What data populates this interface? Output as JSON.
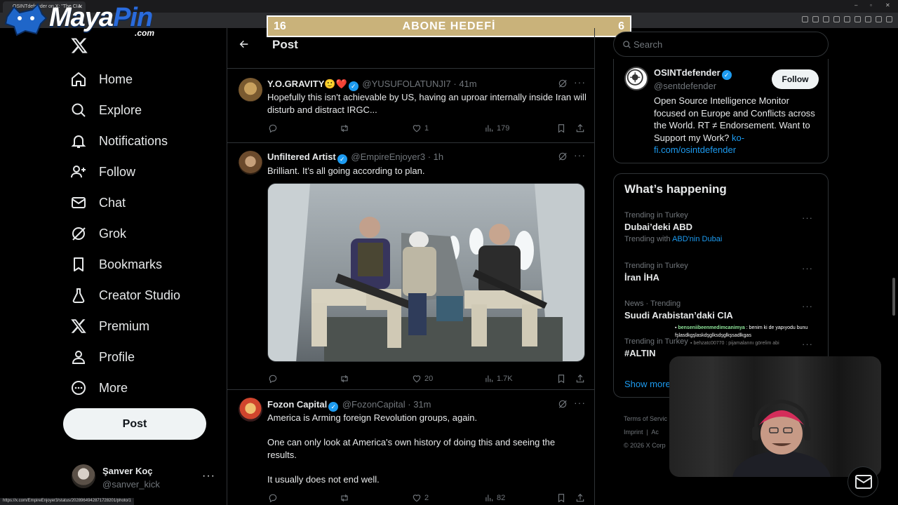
{
  "browser": {
    "tab_title": "OSINTdefender on X: \"The CIA",
    "status_url": "https://x.com/EmpireEnjoyer3/status/2028964942871728201/photo/1"
  },
  "overlay": {
    "logo": {
      "maya": "Maya",
      "pin": "Pin",
      "com": ".com"
    },
    "goal": {
      "left": "16",
      "label": "ABONE HEDEFİ",
      "right": "6"
    }
  },
  "nav": {
    "items": [
      {
        "label": "Home",
        "icon": "home-icon"
      },
      {
        "label": "Explore",
        "icon": "search-icon"
      },
      {
        "label": "Notifications",
        "icon": "bell-icon"
      },
      {
        "label": "Follow",
        "icon": "add-user-icon"
      },
      {
        "label": "Chat",
        "icon": "mail-icon"
      },
      {
        "label": "Grok",
        "icon": "grok-icon"
      },
      {
        "label": "Bookmarks",
        "icon": "bookmark-icon"
      },
      {
        "label": "Creator Studio",
        "icon": "flask-icon"
      },
      {
        "label": "Premium",
        "icon": "x-icon"
      },
      {
        "label": "Profile",
        "icon": "person-icon"
      },
      {
        "label": "More",
        "icon": "more-circle-icon"
      }
    ],
    "post_label": "Post",
    "account": {
      "name": "Şanver Koç",
      "handle": "@sanver_kick",
      "more": "···"
    }
  },
  "main": {
    "title": "Post",
    "tweets": [
      {
        "name": "Y.O.GRAVITY",
        "emoji": "🙂❤️",
        "handle": "@YUSUFOLATUNJI7",
        "time": "· 41m",
        "body": [
          "Hopefully this isn't achievable by US, having an uproar internally inside Iran will disturb and distract IRGC..."
        ],
        "likes": "1",
        "views": "179"
      },
      {
        "name": "Unfiltered Artist",
        "handle": "@EmpireEnjoyer3",
        "time": "· 1h",
        "body": [
          "Brilliant. It’s all going according to plan."
        ],
        "likes": "20",
        "views": "1.7K"
      },
      {
        "name": "Fozon Capital",
        "handle": "@FozonCapital",
        "time": "· 31m",
        "body": [
          "America is Arming foreign Revolution groups, again.",
          "One can only look at America's own history of doing this and seeing the results.",
          "It usually does not end well."
        ],
        "likes": "2",
        "views": "82"
      }
    ]
  },
  "sidebar": {
    "search_placeholder": "Search",
    "profile": {
      "name": "OSINTdefender",
      "handle": "@sentdefender",
      "follow_label": "Follow",
      "bio": "Open Source Intelligence Monitor focused on Europe and Conflicts across the World. RT ≠ Endorsement. Want to Support my Work? ",
      "link": "ko-fi.com/osintdefender"
    },
    "happening_title": "What’s happening",
    "trends": [
      {
        "context": "Trending in Turkey",
        "name": "Dubai’deki ABD",
        "with_label": "Trending with",
        "with_link": "ABD'nin Dubai"
      },
      {
        "context": "Trending in Turkey",
        "name": "İran İHA"
      },
      {
        "context": "News · Trending",
        "name": "Suudi Arabistan’daki CIA"
      },
      {
        "context": "Trending in Turkey",
        "name": "#ALTIN"
      }
    ],
    "show_more": "Show more",
    "footer": {
      "line1": "Terms of Servic",
      "imprint": "Imprint",
      "sep": "|",
      "acc": "Ac",
      "copy": "© 2026 X Corp"
    }
  },
  "stream_chat": [
    {
      "user": "benseniibeenmedimcanimya",
      "text": " : benim ki de yapıyodu bunu fşlasdkgşlaskdşglksdşglkşsadlkgas"
    },
    {
      "user": "behzatc00770",
      "text": " : pijamalarını görelim abi"
    }
  ],
  "colors": {
    "accent": "#1d9bf0",
    "goal_bg": "#c9b27a",
    "background": "#000000"
  }
}
